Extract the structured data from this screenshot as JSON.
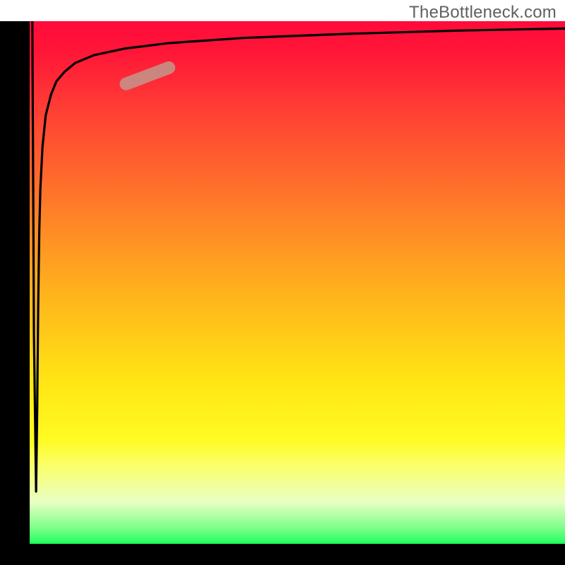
{
  "watermark_text": "TheBottleneck.com",
  "colors": {
    "gradient_top": "#ff0b3b",
    "gradient_mid_red": "#ff3b35",
    "gradient_orange": "#ffa61f",
    "gradient_yellow": "#ffe313",
    "gradient_pale": "#fbff6a",
    "gradient_green": "#1eff5e",
    "axis": "#000000",
    "curve": "#000000",
    "marker": "#c78e86",
    "watermark": "#606060"
  },
  "chart_data": {
    "type": "line",
    "title": "",
    "xlabel": "",
    "ylabel": "",
    "xlim": [
      0,
      100
    ],
    "ylim": [
      0,
      100
    ],
    "series": [
      {
        "name": "bottleneck-curve",
        "x": [
          0.5,
          0.8,
          1.2,
          1.4,
          1.6,
          1.8,
          2.0,
          2.4,
          3.0,
          4.0,
          5.0,
          6.5,
          8.5,
          12,
          18,
          26,
          40,
          60,
          80,
          100
        ],
        "y": [
          100,
          40,
          10,
          25,
          46,
          60,
          68,
          76,
          82,
          86,
          88.5,
          90.3,
          92,
          93.5,
          94.8,
          95.8,
          96.8,
          97.6,
          98.2,
          98.6
        ]
      }
    ],
    "marker": {
      "x_range": [
        18,
        26
      ],
      "y_range": [
        88,
        91.1
      ]
    },
    "background_gradient": {
      "orientation": "vertical",
      "stops": [
        {
          "pos": 0.0,
          "color": "#ff0b3b"
        },
        {
          "pos": 0.3,
          "color": "#ff6a2c"
        },
        {
          "pos": 0.48,
          "color": "#ffa61f"
        },
        {
          "pos": 0.68,
          "color": "#ffe313"
        },
        {
          "pos": 0.85,
          "color": "#fbff6a"
        },
        {
          "pos": 1.0,
          "color": "#1eff5e"
        }
      ]
    }
  }
}
